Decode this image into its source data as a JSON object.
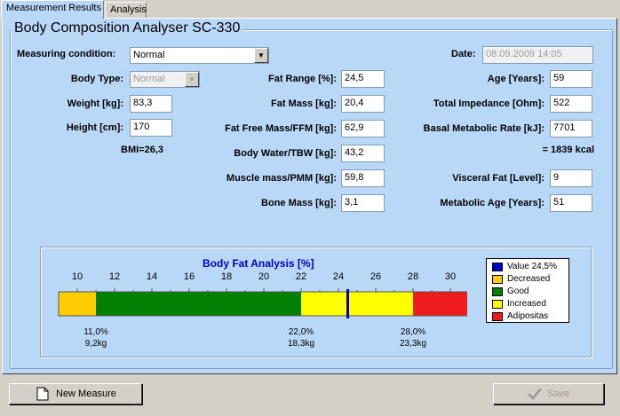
{
  "tabs": [
    {
      "label": "Measurement Results",
      "active": true
    },
    {
      "label": "Analysis",
      "active": false
    }
  ],
  "group_title": "Body Composition Analyser SC-330",
  "measuring_condition": {
    "label": "Measuring condition:",
    "value": "Normal"
  },
  "date": {
    "label": "Date:",
    "value": "08.09.2009 14:05"
  },
  "body_type": {
    "label": "Body Type:",
    "value": "Normal"
  },
  "weight": {
    "label": "Weight [kg]:",
    "value": "83,3"
  },
  "height": {
    "label": "Height [cm]:",
    "value": "170"
  },
  "bmi": "BMI=26,3",
  "fat_range": {
    "label": "Fat Range [%]:",
    "value": "24,5"
  },
  "fat_mass": {
    "label": "Fat Mass [kg]:",
    "value": "20,4"
  },
  "ffm": {
    "label": "Fat Free Mass/FFM [kg]:",
    "value": "62,9"
  },
  "tbw": {
    "label": "Body Water/TBW [kg]:",
    "value": "43,2"
  },
  "pmm": {
    "label": "Muscle mass/PMM [kg]:",
    "value": "59,8"
  },
  "bone": {
    "label": "Bone Mass [kg]:",
    "value": "3,1"
  },
  "age": {
    "label": "Age [Years]:",
    "value": "59"
  },
  "impedance": {
    "label": "Total Impedance [Ohm]:",
    "value": "522"
  },
  "bmr": {
    "label": "Basal Metabolic Rate [kJ]:",
    "value": "7701"
  },
  "kcal": "= 1839 kcal",
  "visceral": {
    "label": "Visceral Fat [Level]:",
    "value": "9"
  },
  "metabolic_age": {
    "label": "Metabolic Age [Years]:",
    "value": "51"
  },
  "buttons": {
    "new_measure": "New Measure",
    "save": "Save"
  },
  "colors": {
    "panel_bg": "#b9d8f8",
    "decreased": "#ffcc00",
    "good": "#008000",
    "increased": "#ffff00",
    "adipositas": "#ee1c1c",
    "value_marker": "#0000cc"
  },
  "chart_data": {
    "type": "bar",
    "title": "Body Fat Analysis [%]",
    "xlim": [
      9,
      31
    ],
    "ticks": [
      "10",
      "12",
      "14",
      "16",
      "18",
      "20",
      "22",
      "24",
      "26",
      "28",
      "30"
    ],
    "tick_values": [
      10,
      12,
      14,
      16,
      18,
      20,
      22,
      24,
      26,
      28,
      30
    ],
    "segments": [
      {
        "name": "Decreased",
        "from": 9,
        "to": 11,
        "color": "#ffcc00"
      },
      {
        "name": "Good",
        "from": 11,
        "to": 22,
        "color": "#008000"
      },
      {
        "name": "Increased",
        "from": 22,
        "to": 28,
        "color": "#ffff00"
      },
      {
        "name": "Adipositas",
        "from": 28,
        "to": 31,
        "color": "#ee1c1c"
      }
    ],
    "value": 24.5,
    "boundaries": [
      {
        "at": 11,
        "pct": "11,0%",
        "kg": "9,2kg"
      },
      {
        "at": 22,
        "pct": "22,0%",
        "kg": "18,3kg"
      },
      {
        "at": 28,
        "pct": "28,0%",
        "kg": "23,3kg"
      }
    ],
    "legend": [
      {
        "label": "Value 24,5%",
        "color": "#0000cc"
      },
      {
        "label": "Decreased",
        "color": "#ffcc00"
      },
      {
        "label": "Good",
        "color": "#008000"
      },
      {
        "label": "Increased",
        "color": "#ffff00"
      },
      {
        "label": "Adipositas",
        "color": "#ee1c1c"
      }
    ]
  }
}
